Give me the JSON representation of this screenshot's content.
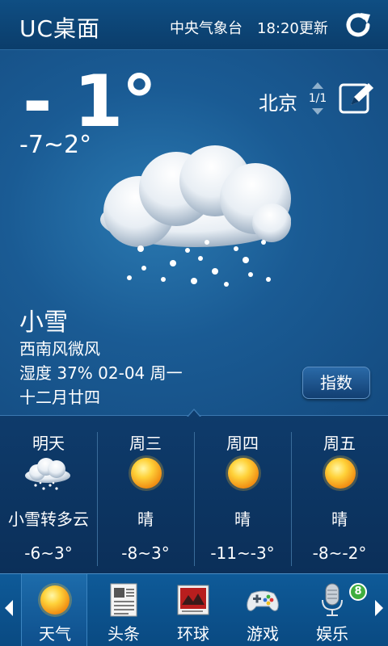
{
  "header": {
    "app_title": "UC桌面",
    "source": "中央气象台",
    "update_time": "18:20更新",
    "refresh_icon": "refresh-icon"
  },
  "current": {
    "temperature": "- 1°",
    "range": "-7~2°",
    "city": "北京",
    "page_indicator": "1/1",
    "condition": "小雪",
    "wind": "西南风微风",
    "humidity_date": "湿度 37%  02-04  周一",
    "lunar_date": "十二月廿四",
    "index_button": "指数",
    "weather_icon": "light-snow-cloud-icon"
  },
  "forecast": [
    {
      "day": "明天",
      "condition": "小雪转多云",
      "temp": "-6~3°",
      "icon": "snow-cloud-icon"
    },
    {
      "day": "周三",
      "condition": "晴",
      "temp": "-8~3°",
      "icon": "sun-icon"
    },
    {
      "day": "周四",
      "condition": "晴",
      "temp": "-11~-3°",
      "icon": "sun-icon"
    },
    {
      "day": "周五",
      "condition": "晴",
      "temp": "-8~-2°",
      "icon": "sun-icon"
    }
  ],
  "nav": {
    "items": [
      {
        "label": "天气",
        "icon": "sun-icon"
      },
      {
        "label": "头条",
        "icon": "newspaper-icon"
      },
      {
        "label": "环球",
        "icon": "magazine-icon"
      },
      {
        "label": "游戏",
        "icon": "gamepad-icon"
      },
      {
        "label": "娱乐",
        "icon": "microphone-icon"
      }
    ],
    "badge": "8"
  },
  "colors": {
    "header_bg": "#0f4e83",
    "main_bg": "#1a5b94",
    "forecast_bg": "#0e3b6b",
    "nav_bg": "#0e5a98",
    "sun": "#f6c12c",
    "badge": "#3fae3f"
  }
}
